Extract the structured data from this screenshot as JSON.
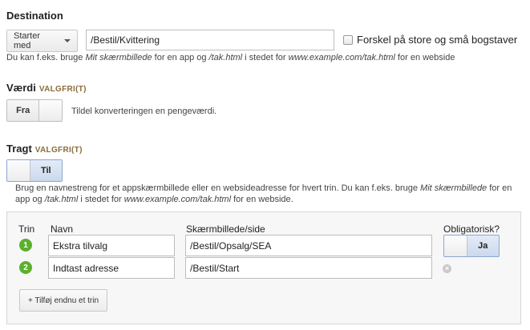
{
  "destination": {
    "heading": "Destination",
    "match_type": "Starter med",
    "value": "/Bestil/Kvittering",
    "case_sensitive_label": "Forskel på store og små bogstaver",
    "hint_pre": "Du kan f.eks. bruge ",
    "hint_em1": "Mit skærmbillede",
    "hint_mid1": " for en app og ",
    "hint_em2": "/tak.html",
    "hint_mid2": " i stedet for ",
    "hint_em3": "www.example.com/tak.html",
    "hint_post": " for en webside"
  },
  "value_section": {
    "heading": "Værdi",
    "optional": "VALGFRI(T)",
    "toggle_label": "Fra",
    "hint": "Tildel konverteringen en pengeværdi."
  },
  "funnel": {
    "heading": "Tragt",
    "optional": "VALGFRI(T)",
    "toggle_label": "Til",
    "hint1_pre": "Brug en navnestreng for et appskærmbillede eller en websideadresse for hvert trin. Du kan f.eks. bruge ",
    "hint1_em": "Mit skærmbillede",
    "hint1_post": " for en",
    "hint2_pre": "app og ",
    "hint2_em1": "/tak.html",
    "hint2_mid": " i stedet for ",
    "hint2_em2": "www.example.com/tak.html",
    "hint2_post": " for en webside.",
    "columns": {
      "step": "Trin",
      "name": "Navn",
      "screen": "Skærmbillede/side",
      "required": "Obligatorisk?"
    },
    "steps": [
      {
        "num": "1",
        "name": "Ekstra tilvalg",
        "screen": "/Bestil/Opsalg/SEA"
      },
      {
        "num": "2",
        "name": "Indtast adresse",
        "screen": "/Bestil/Start"
      }
    ],
    "required_toggle_label": "Ja",
    "add_step_label": "+ Tilføj endnu et trin"
  },
  "colors": {
    "step_green": "#5cb02e",
    "optional_brown": "#8a6d3b",
    "toggle_on_blue": "#cbd9ee"
  }
}
